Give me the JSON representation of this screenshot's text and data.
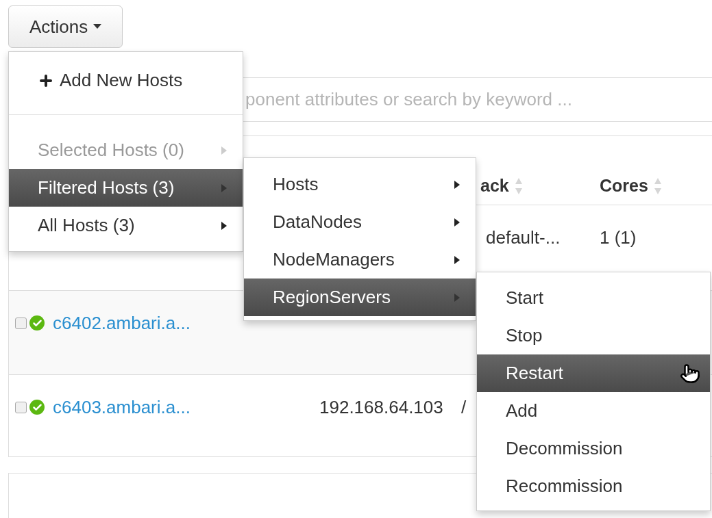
{
  "actions_button": {
    "label": "Actions"
  },
  "search": {
    "placeholder": "ponent attributes or search by keyword ..."
  },
  "table": {
    "columns": [
      {
        "label": "ack"
      },
      {
        "label": "Cores"
      }
    ],
    "rows": [
      {
        "rack": "default-...",
        "cores": "1 (1)"
      },
      {
        "host": "c6402.ambari.a...",
        "checked": false,
        "healthy": true
      },
      {
        "host": "c6403.ambari.a...",
        "checked": false,
        "healthy": true,
        "ip": "192.168.64.103",
        "rack": "/"
      }
    ]
  },
  "actions_menu": {
    "items": [
      {
        "kind": "add",
        "label": "Add New Hosts",
        "selected": false,
        "disabled": false
      },
      {
        "kind": "divider"
      },
      {
        "kind": "submenu",
        "label": "Selected Hosts (0)",
        "selected": false,
        "disabled": true
      },
      {
        "kind": "submenu",
        "label": "Filtered Hosts (3)",
        "selected": true,
        "disabled": false
      },
      {
        "kind": "submenu",
        "label": "All Hosts (3)",
        "selected": false,
        "disabled": false
      }
    ]
  },
  "filtered_submenu": {
    "items": [
      {
        "kind": "submenu",
        "label": "Hosts",
        "selected": false
      },
      {
        "kind": "submenu",
        "label": "DataNodes",
        "selected": false
      },
      {
        "kind": "submenu",
        "label": "NodeManagers",
        "selected": false
      },
      {
        "kind": "submenu",
        "label": "RegionServers",
        "selected": true
      }
    ]
  },
  "regionservers_submenu": {
    "items": [
      {
        "kind": "action",
        "label": "Start",
        "selected": false
      },
      {
        "kind": "action",
        "label": "Stop",
        "selected": false
      },
      {
        "kind": "action",
        "label": "Restart",
        "selected": true,
        "hovered": true
      },
      {
        "kind": "action",
        "label": "Add",
        "selected": false
      },
      {
        "kind": "action",
        "label": "Decommission",
        "selected": false
      },
      {
        "kind": "action",
        "label": "Recommission",
        "selected": false
      }
    ]
  }
}
